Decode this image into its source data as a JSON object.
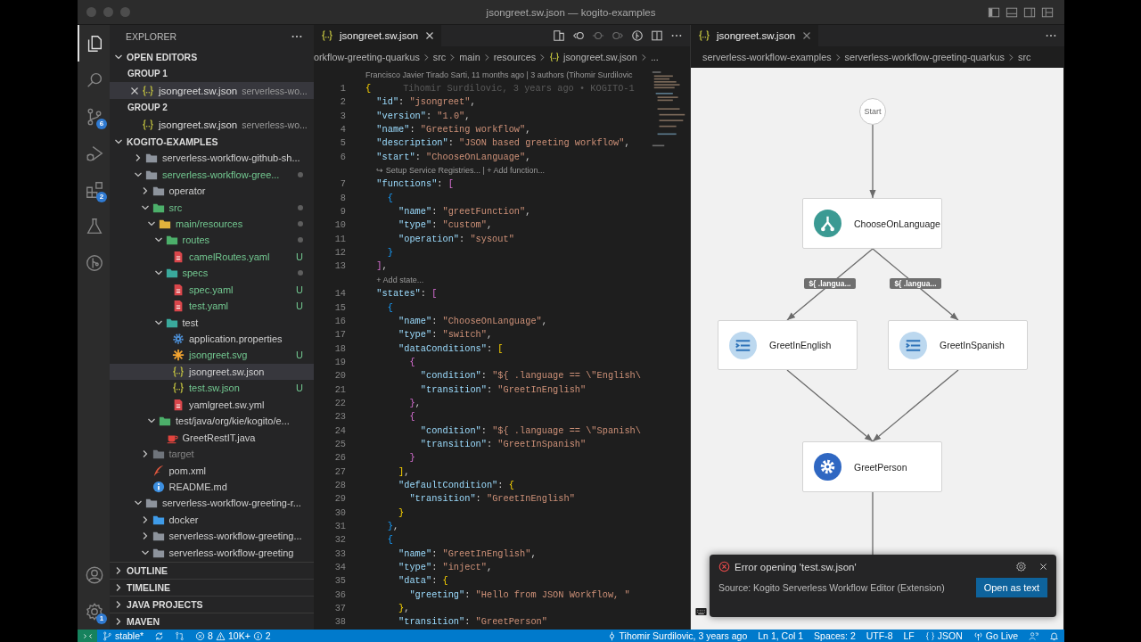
{
  "window": {
    "title": "jsongreet.sw.json — kogito-examples"
  },
  "activity_bar": {
    "items": [
      {
        "kind": "files",
        "selected": true
      },
      {
        "kind": "search",
        "selected": false
      },
      {
        "kind": "source-control",
        "selected": false,
        "badge": "6"
      },
      {
        "kind": "run",
        "selected": false
      },
      {
        "kind": "extensions",
        "selected": false,
        "badge": "2"
      },
      {
        "kind": "testing",
        "selected": false
      },
      {
        "kind": "git-graph",
        "selected": false
      }
    ],
    "bottom": [
      {
        "kind": "account"
      },
      {
        "kind": "settings",
        "badge": "1"
      }
    ]
  },
  "sidebar": {
    "title": "EXPLORER"
  },
  "open_editors": {
    "title": "OPEN EDITORS",
    "expanded": true,
    "groups": [
      {
        "title": "GROUP 1",
        "items": [
          {
            "name": "jsongreet.sw.json",
            "description": "serverless-wo...",
            "selected": true
          }
        ]
      },
      {
        "title": "GROUP 2",
        "items": [
          {
            "name": "jsongreet.sw.json",
            "description": "serverless-wo...",
            "selected": false
          }
        ]
      }
    ]
  },
  "workspace": {
    "title": "KOGITO-EXAMPLES",
    "expanded": true,
    "tree": [
      {
        "label": "serverless-workflow-github-sh...",
        "kind": "folder",
        "expanded": false,
        "selected": false,
        "untracked": false,
        "ignored": false,
        "dot": false
      },
      {
        "label": "serverless-workflow-gree...",
        "kind": "folder",
        "expanded": true,
        "selected": false,
        "untracked": true,
        "ignored": false,
        "dot": true,
        "children": [
          {
            "label": "operator",
            "kind": "folder",
            "expanded": false,
            "selected": false,
            "untracked": false,
            "ignored": false,
            "dot": false
          },
          {
            "label": "src",
            "kind": "folder-green",
            "expanded": true,
            "selected": false,
            "untracked": true,
            "ignored": false,
            "dot": true,
            "children": [
              {
                "label": "main/resources",
                "kind": "folder-yellow",
                "expanded": true,
                "selected": false,
                "untracked": true,
                "ignored": false,
                "dot": true,
                "children": [
                  {
                    "label": "routes",
                    "kind": "folder-green",
                    "expanded": true,
                    "selected": false,
                    "untracked": true,
                    "ignored": false,
                    "dot": true,
                    "children": [
                      {
                        "label": "camelRoutes.yaml",
                        "kind": "yaml",
                        "selected": false,
                        "untracked": true,
                        "ignored": false,
                        "dot": false,
                        "badge": "U"
                      }
                    ]
                  },
                  {
                    "label": "specs",
                    "kind": "folder-teal",
                    "expanded": true,
                    "selected": false,
                    "untracked": true,
                    "ignored": false,
                    "dot": true,
                    "children": [
                      {
                        "label": "spec.yaml",
                        "kind": "yaml",
                        "selected": false,
                        "untracked": true,
                        "ignored": false,
                        "dot": false,
                        "badge": "U"
                      },
                      {
                        "label": "test.yaml",
                        "kind": "yaml",
                        "selected": false,
                        "untracked": true,
                        "ignored": false,
                        "dot": false,
                        "badge": "U"
                      }
                    ]
                  },
                  {
                    "label": "test",
                    "kind": "folder-teal",
                    "expanded": true,
                    "selected": false,
                    "untracked": false,
                    "ignored": false,
                    "dot": false,
                    "children": [
                      {
                        "label": "application.properties",
                        "kind": "gear",
                        "selected": false,
                        "untracked": false,
                        "ignored": false,
                        "dot": false
                      },
                      {
                        "label": "jsongreet.svg",
                        "kind": "svg",
                        "selected": false,
                        "untracked": true,
                        "ignored": false,
                        "dot": false,
                        "badge": "U"
                      },
                      {
                        "label": "jsongreet.sw.json",
                        "kind": "json",
                        "selected": true,
                        "untracked": false,
                        "ignored": false,
                        "dot": false
                      },
                      {
                        "label": "test.sw.json",
                        "kind": "json",
                        "selected": false,
                        "untracked": true,
                        "ignored": false,
                        "dot": false,
                        "badge": "U"
                      },
                      {
                        "label": "yamlgreet.sw.yml",
                        "kind": "yaml",
                        "selected": false,
                        "untracked": false,
                        "ignored": false,
                        "dot": false
                      }
                    ]
                  }
                ]
              },
              {
                "label": "test/java/org/kie/kogito/e...",
                "kind": "folder-green",
                "expanded": true,
                "selected": false,
                "untracked": false,
                "ignored": false,
                "dot": false,
                "children": [
                  {
                    "label": "GreetRestIT.java",
                    "kind": "java",
                    "selected": false,
                    "untracked": false,
                    "ignored": false,
                    "dot": false
                  }
                ]
              }
            ]
          },
          {
            "label": "target",
            "kind": "folder-target",
            "expanded": false,
            "selected": false,
            "untracked": false,
            "ignored": true,
            "dot": false
          },
          {
            "label": "pom.xml",
            "kind": "xml",
            "selected": false,
            "untracked": false,
            "ignored": false,
            "dot": false
          },
          {
            "label": "README.md",
            "kind": "info",
            "selected": false,
            "untracked": false,
            "ignored": false,
            "dot": false
          }
        ]
      },
      {
        "label": "serverless-workflow-greeting-r...",
        "kind": "folder",
        "expanded": true,
        "selected": false,
        "untracked": false,
        "ignored": false,
        "dot": false,
        "children": [
          {
            "label": "docker",
            "kind": "folder-blue",
            "expanded": false,
            "selected": false,
            "untracked": false,
            "ignored": false,
            "dot": false
          },
          {
            "label": "serverless-workflow-greeting...",
            "kind": "folder",
            "expanded": false,
            "selected": false,
            "untracked": false,
            "ignored": false,
            "dot": false
          },
          {
            "label": "serverless-workflow-greeting",
            "kind": "folder",
            "expanded": true,
            "selected": false,
            "untracked": false,
            "ignored": false,
            "dot": false
          }
        ]
      }
    ]
  },
  "sections": [
    {
      "title": "OUTLINE",
      "expanded": false
    },
    {
      "title": "TIMELINE",
      "expanded": false
    },
    {
      "title": "JAVA PROJECTS",
      "expanded": false
    },
    {
      "title": "MAVEN",
      "expanded": false
    }
  ],
  "editor": {
    "tab": {
      "label": "jsongreet.sw.json",
      "selected": true
    },
    "breadcrumb": [
      {
        "label": "orkflow-greeting-quarkus"
      },
      {
        "label": "src"
      },
      {
        "label": "main"
      },
      {
        "label": "resources"
      },
      {
        "label": "jsongreet.sw.json",
        "kind": "json"
      },
      {
        "label": "..."
      }
    ],
    "lines": [
      {
        "kind": "lens",
        "text": "Francisco Javier Tirado Sarti, 11 months ago | 3 authors (Tihomir Surdilovic"
      },
      {
        "kind": "code",
        "n": "1",
        "parts": [
          {
            "kind": "b1",
            "text": "{"
          }
        ],
        "blame": "Tihomir Surdilovic, 3 years ago • KOGITO-1"
      },
      {
        "kind": "code",
        "n": "2",
        "parts": [
          {
            "kind": "key",
            "text": "  \"id\""
          },
          {
            "kind": "p",
            "text": ": "
          },
          {
            "kind": "str",
            "text": "\"jsongreet\""
          },
          {
            "kind": "p",
            "text": ","
          }
        ]
      },
      {
        "kind": "code",
        "n": "3",
        "parts": [
          {
            "kind": "key",
            "text": "  \"version\""
          },
          {
            "kind": "p",
            "text": ": "
          },
          {
            "kind": "str",
            "text": "\"1.0\""
          },
          {
            "kind": "p",
            "text": ","
          }
        ]
      },
      {
        "kind": "code",
        "n": "4",
        "parts": [
          {
            "kind": "key",
            "text": "  \"name\""
          },
          {
            "kind": "p",
            "text": ": "
          },
          {
            "kind": "str",
            "text": "\"Greeting workflow\""
          },
          {
            "kind": "p",
            "text": ","
          }
        ]
      },
      {
        "kind": "code",
        "n": "5",
        "parts": [
          {
            "kind": "key",
            "text": "  \"description\""
          },
          {
            "kind": "p",
            "text": ": "
          },
          {
            "kind": "str",
            "text": "\"JSON based greeting workflow\""
          },
          {
            "kind": "p",
            "text": ","
          }
        ]
      },
      {
        "kind": "code",
        "n": "6",
        "parts": [
          {
            "kind": "key",
            "text": "  \"start\""
          },
          {
            "kind": "p",
            "text": ": "
          },
          {
            "kind": "str",
            "text": "\"ChooseOnLanguage\""
          },
          {
            "kind": "p",
            "text": ","
          }
        ]
      },
      {
        "kind": "lens",
        "text": "↪ Setup Service Registries... | + Add function..."
      },
      {
        "kind": "code",
        "n": "7",
        "parts": [
          {
            "kind": "key",
            "text": "  \"functions\""
          },
          {
            "kind": "p",
            "text": ": "
          },
          {
            "kind": "b2",
            "text": "["
          }
        ]
      },
      {
        "kind": "code",
        "n": "8",
        "parts": [
          {
            "kind": "b3",
            "text": "    {"
          }
        ]
      },
      {
        "kind": "code",
        "n": "9",
        "parts": [
          {
            "kind": "key",
            "text": "      \"name\""
          },
          {
            "kind": "p",
            "text": ": "
          },
          {
            "kind": "str",
            "text": "\"greetFunction\""
          },
          {
            "kind": "p",
            "text": ","
          }
        ]
      },
      {
        "kind": "code",
        "n": "10",
        "parts": [
          {
            "kind": "key",
            "text": "      \"type\""
          },
          {
            "kind": "p",
            "text": ": "
          },
          {
            "kind": "str",
            "text": "\"custom\""
          },
          {
            "kind": "p",
            "text": ","
          }
        ]
      },
      {
        "kind": "code",
        "n": "11",
        "parts": [
          {
            "kind": "key",
            "text": "      \"operation\""
          },
          {
            "kind": "p",
            "text": ": "
          },
          {
            "kind": "str",
            "text": "\"sysout\""
          }
        ]
      },
      {
        "kind": "code",
        "n": "12",
        "parts": [
          {
            "kind": "b3",
            "text": "    }"
          }
        ]
      },
      {
        "kind": "code",
        "n": "13",
        "parts": [
          {
            "kind": "b2",
            "text": "  ]"
          },
          {
            "kind": "p",
            "text": ","
          }
        ]
      },
      {
        "kind": "lens",
        "text": "+ Add state..."
      },
      {
        "kind": "code",
        "n": "14",
        "parts": [
          {
            "kind": "key",
            "text": "  \"states\""
          },
          {
            "kind": "p",
            "text": ": "
          },
          {
            "kind": "b2",
            "text": "["
          }
        ]
      },
      {
        "kind": "code",
        "n": "15",
        "parts": [
          {
            "kind": "b3",
            "text": "    {"
          }
        ]
      },
      {
        "kind": "code",
        "n": "16",
        "parts": [
          {
            "kind": "key",
            "text": "      \"name\""
          },
          {
            "kind": "p",
            "text": ": "
          },
          {
            "kind": "str",
            "text": "\"ChooseOnLanguage\""
          },
          {
            "kind": "p",
            "text": ","
          }
        ]
      },
      {
        "kind": "code",
        "n": "17",
        "parts": [
          {
            "kind": "key",
            "text": "      \"type\""
          },
          {
            "kind": "p",
            "text": ": "
          },
          {
            "kind": "str",
            "text": "\"switch\""
          },
          {
            "kind": "p",
            "text": ","
          }
        ]
      },
      {
        "kind": "code",
        "n": "18",
        "parts": [
          {
            "kind": "key",
            "text": "      \"dataConditions\""
          },
          {
            "kind": "p",
            "text": ": "
          },
          {
            "kind": "b1",
            "text": "["
          }
        ]
      },
      {
        "kind": "code",
        "n": "19",
        "parts": [
          {
            "kind": "b2",
            "text": "        {"
          }
        ]
      },
      {
        "kind": "code",
        "n": "20",
        "parts": [
          {
            "kind": "key",
            "text": "          \"condition\""
          },
          {
            "kind": "p",
            "text": ": "
          },
          {
            "kind": "str",
            "text": "\"${ .language == \\\"English\\"
          }
        ]
      },
      {
        "kind": "code",
        "n": "21",
        "parts": [
          {
            "kind": "key",
            "text": "          \"transition\""
          },
          {
            "kind": "p",
            "text": ": "
          },
          {
            "kind": "str",
            "text": "\"GreetInEnglish\""
          }
        ]
      },
      {
        "kind": "code",
        "n": "22",
        "parts": [
          {
            "kind": "b2",
            "text": "        }"
          },
          {
            "kind": "p",
            "text": ","
          }
        ]
      },
      {
        "kind": "code",
        "n": "23",
        "parts": [
          {
            "kind": "b2",
            "text": "        {"
          }
        ]
      },
      {
        "kind": "code",
        "n": "24",
        "parts": [
          {
            "kind": "key",
            "text": "          \"condition\""
          },
          {
            "kind": "p",
            "text": ": "
          },
          {
            "kind": "str",
            "text": "\"${ .language == \\\"Spanish\\"
          }
        ]
      },
      {
        "kind": "code",
        "n": "25",
        "parts": [
          {
            "kind": "key",
            "text": "          \"transition\""
          },
          {
            "kind": "p",
            "text": ": "
          },
          {
            "kind": "str",
            "text": "\"GreetInSpanish\""
          }
        ]
      },
      {
        "kind": "code",
        "n": "26",
        "parts": [
          {
            "kind": "b2",
            "text": "        }"
          }
        ]
      },
      {
        "kind": "code",
        "n": "27",
        "parts": [
          {
            "kind": "b1",
            "text": "      ]"
          },
          {
            "kind": "p",
            "text": ","
          }
        ]
      },
      {
        "kind": "code",
        "n": "28",
        "parts": [
          {
            "kind": "key",
            "text": "      \"defaultCondition\""
          },
          {
            "kind": "p",
            "text": ": "
          },
          {
            "kind": "b1",
            "text": "{"
          }
        ]
      },
      {
        "kind": "code",
        "n": "29",
        "parts": [
          {
            "kind": "key",
            "text": "        \"transition\""
          },
          {
            "kind": "p",
            "text": ": "
          },
          {
            "kind": "str",
            "text": "\"GreetInEnglish\""
          }
        ]
      },
      {
        "kind": "code",
        "n": "30",
        "parts": [
          {
            "kind": "b1",
            "text": "      }"
          }
        ]
      },
      {
        "kind": "code",
        "n": "31",
        "parts": [
          {
            "kind": "b3",
            "text": "    }"
          },
          {
            "kind": "p",
            "text": ","
          }
        ]
      },
      {
        "kind": "code",
        "n": "32",
        "parts": [
          {
            "kind": "b3",
            "text": "    {"
          }
        ]
      },
      {
        "kind": "code",
        "n": "33",
        "parts": [
          {
            "kind": "key",
            "text": "      \"name\""
          },
          {
            "kind": "p",
            "text": ": "
          },
          {
            "kind": "str",
            "text": "\"GreetInEnglish\""
          },
          {
            "kind": "p",
            "text": ","
          }
        ]
      },
      {
        "kind": "code",
        "n": "34",
        "parts": [
          {
            "kind": "key",
            "text": "      \"type\""
          },
          {
            "kind": "p",
            "text": ": "
          },
          {
            "kind": "str",
            "text": "\"inject\""
          },
          {
            "kind": "p",
            "text": ","
          }
        ]
      },
      {
        "kind": "code",
        "n": "35",
        "parts": [
          {
            "kind": "key",
            "text": "      \"data\""
          },
          {
            "kind": "p",
            "text": ": "
          },
          {
            "kind": "b1",
            "text": "{"
          }
        ]
      },
      {
        "kind": "code",
        "n": "36",
        "parts": [
          {
            "kind": "key",
            "text": "        \"greeting\""
          },
          {
            "kind": "p",
            "text": ": "
          },
          {
            "kind": "str",
            "text": "\"Hello from JSON Workflow, \""
          }
        ]
      },
      {
        "kind": "code",
        "n": "37",
        "parts": [
          {
            "kind": "b1",
            "text": "      }"
          },
          {
            "kind": "p",
            "text": ","
          }
        ]
      },
      {
        "kind": "code",
        "n": "38",
        "parts": [
          {
            "kind": "key",
            "text": "      \"transition\""
          },
          {
            "kind": "p",
            "text": ": "
          },
          {
            "kind": "str",
            "text": "\"GreetPerson\""
          }
        ]
      }
    ]
  },
  "diagram_panel": {
    "tab": {
      "label": "jsongreet.sw.json",
      "selected": true
    },
    "breadcrumb": [
      {
        "label": "serverless-workflow-examples"
      },
      {
        "label": "serverless-workflow-greeting-quarkus"
      },
      {
        "label": "src"
      }
    ],
    "nodes": [
      {
        "kind": "start",
        "label": "Start"
      },
      {
        "kind": "switch",
        "label": "ChooseOnLanguage"
      },
      {
        "kind": "inject",
        "label": "GreetInEnglish"
      },
      {
        "kind": "inject",
        "label": "GreetInSpanish"
      },
      {
        "kind": "operation",
        "label": "GreetPerson"
      }
    ],
    "edge_labels": [
      "${ .langua...",
      "${ .langua..."
    ]
  },
  "notification": {
    "kind": "error",
    "title": "Error opening 'test.sw.json'",
    "source": "Source: Kogito Serverless Workflow Editor (Extension)",
    "action": "Open as text"
  },
  "status_bar": {
    "branch": "stable*",
    "errors": "8",
    "warnings": "10K+",
    "infos": "2",
    "blame": "Tihomir Surdilovic, 3 years ago",
    "position": "Ln 1, Col 1",
    "spaces": "Spaces: 2",
    "encoding": "UTF-8",
    "eol": "LF",
    "language": "JSON",
    "live": "Go Live"
  }
}
